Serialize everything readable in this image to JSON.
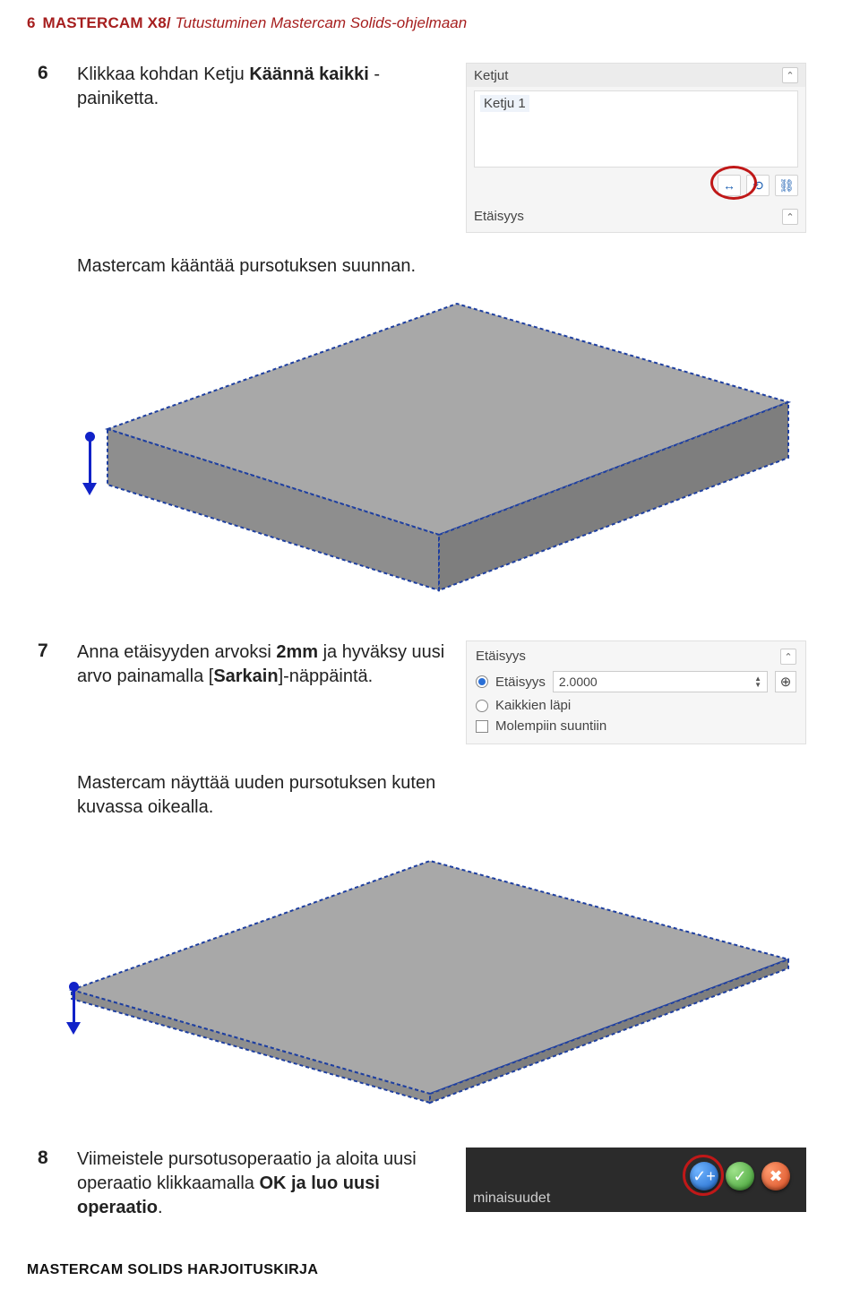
{
  "header": {
    "page_number": "6",
    "book": "MASTERCAM X8/",
    "subtitle": "Tutustuminen Mastercam Solids-ohjelmaan"
  },
  "step6": {
    "num": "6",
    "pre": "Klikkaa kohdan Ketju ",
    "bold": "Käännä kaikki",
    "post": " -painiketta.",
    "note": "Mastercam kääntää pursotuksen suunnan."
  },
  "panel_chains": {
    "title": "Ketjut",
    "item": "Ketju 1",
    "section2": "Etäisyys",
    "btn_swap": "↔",
    "btn_link1": "⟲",
    "btn_link2": "⛓"
  },
  "step7": {
    "num": "7",
    "pre": "Anna etäisyyden arvoksi ",
    "bold1": "2mm",
    "mid": " ja hyväksy uusi arvo painamalla [",
    "bold2": "Sarkain",
    "post": "]-näppäintä.",
    "note": "Mastercam näyttää uuden pursotuksen kuten kuvassa oikealla."
  },
  "panel_dist": {
    "title": "Etäisyys",
    "opt_dist": "Etäisyys",
    "value": "2.0000",
    "opt_all": "Kaikkien läpi",
    "opt_both": "Molempiin suuntiin",
    "target_icon": "⊕"
  },
  "step8": {
    "num": "8",
    "pre": "Viimeistele pursotusoperaatio ja aloita uusi operaatio klikkaamalla ",
    "bold": "OK ja luo uusi operaatio",
    "post": "."
  },
  "status_shot": {
    "text": "minaisuudet",
    "ok_new": "✓+",
    "ok": "✓",
    "cancel": "✖"
  },
  "footer": "MASTERCAM SOLIDS HARJOITUSKIRJA"
}
